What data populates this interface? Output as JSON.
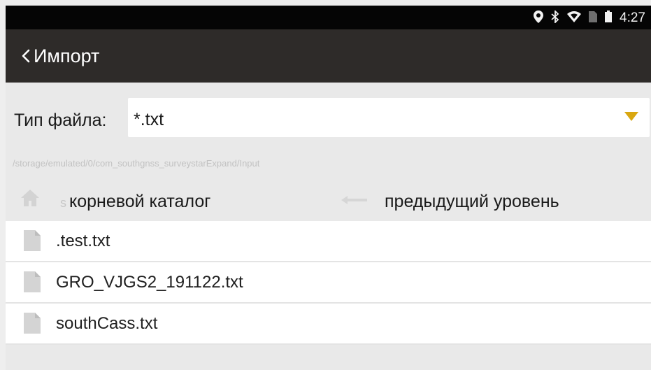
{
  "status_bar": {
    "time": "4:27",
    "icons": [
      "location-icon",
      "bluetooth-icon",
      "wifi-icon",
      "sim-icon",
      "battery-icon"
    ]
  },
  "app_bar": {
    "title": "Импорт",
    "back_icon": "chevron-left-icon"
  },
  "file_type": {
    "label": "Тип файла:",
    "value": "*.txt",
    "arrow_color": "#d9a711"
  },
  "path": "/storage/emulated/0/com_southgnss_surveystarExpand/Input",
  "navigation": {
    "root_mark": "s",
    "root_label": "корневой каталог",
    "up_label": "предыдущий уровень"
  },
  "files": [
    {
      "name": ".test.txt"
    },
    {
      "name": "GRO_VJGS2_191122.txt"
    },
    {
      "name": "southCass.txt"
    }
  ],
  "colors": {
    "status_bar": "#050505",
    "app_bar": "#2e2b29",
    "background": "#e9e9e9",
    "accent": "#d9a711"
  }
}
